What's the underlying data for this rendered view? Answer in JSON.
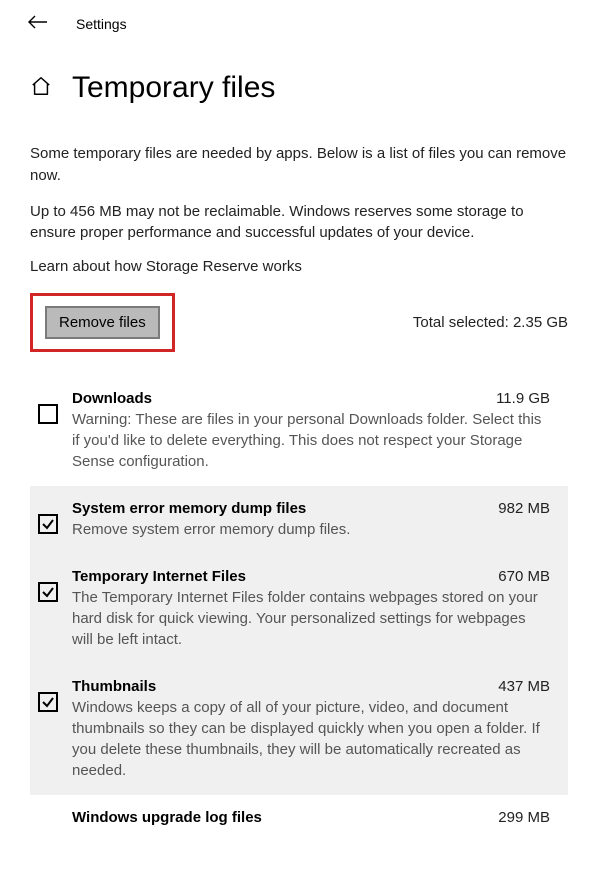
{
  "header": {
    "back_title": "Settings"
  },
  "page": {
    "title": "Temporary files",
    "intro1": "Some temporary files are needed by apps. Below is a list of files you can remove now.",
    "intro2": "Up to 456 MB may not be reclaimable. Windows reserves some storage to ensure proper performance and successful updates of your device.",
    "reserve_link": "Learn about how Storage Reserve works",
    "remove_label": "Remove files",
    "total_label": "Total selected: 2.35 GB"
  },
  "files": [
    {
      "name": "Downloads",
      "size": "11.9 GB",
      "desc": "Warning: These are files in your personal Downloads folder. Select this if you'd like to delete everything. This does not respect your Storage Sense configuration.",
      "checked": false
    },
    {
      "name": "System error memory dump files",
      "size": "982 MB",
      "desc": "Remove system error memory dump files.",
      "checked": true
    },
    {
      "name": "Temporary Internet Files",
      "size": "670 MB",
      "desc": "The Temporary Internet Files folder contains webpages stored on your hard disk for quick viewing. Your personalized settings for webpages will be left intact.",
      "checked": true
    },
    {
      "name": "Thumbnails",
      "size": "437 MB",
      "desc": "Windows keeps a copy of all of your picture, video, and document thumbnails so they can be displayed quickly when you open a folder. If you delete these thumbnails, they will be automatically recreated as needed.",
      "checked": true
    },
    {
      "name": "Windows upgrade log files",
      "size": "299 MB",
      "desc": "",
      "checked": false
    }
  ]
}
